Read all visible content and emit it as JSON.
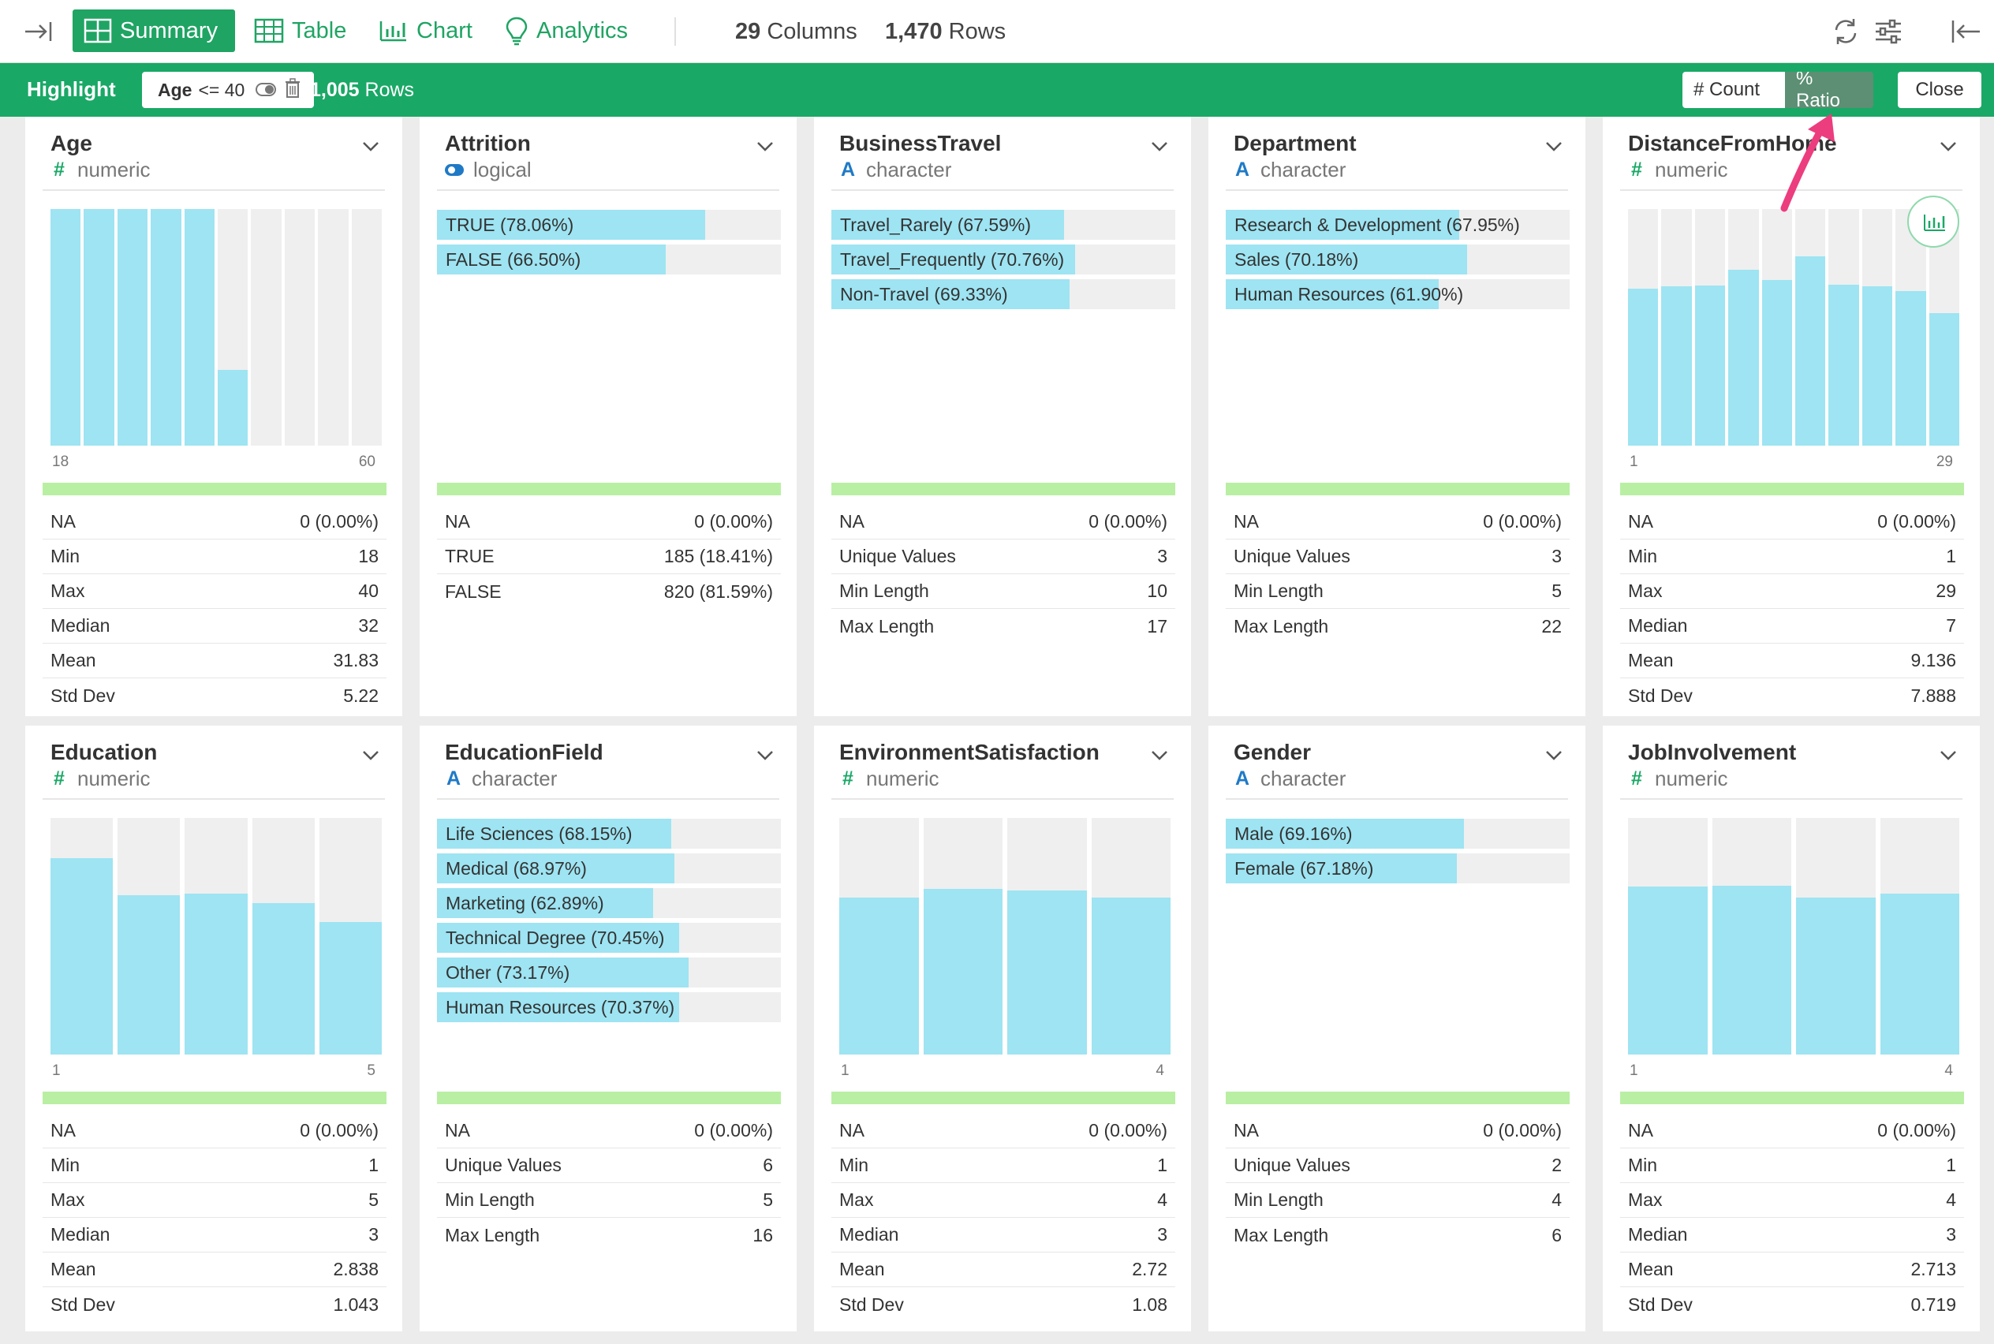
{
  "toolbar": {
    "tabs": [
      "Summary",
      "Table",
      "Chart",
      "Analytics"
    ],
    "columns_count": "29",
    "columns_label": "Columns",
    "rows_count": "1,470",
    "rows_label": "Rows"
  },
  "highlight": {
    "label": "Highlight",
    "filter_column": "Age",
    "filter_condition": "<= 40",
    "rows_count": "1,005",
    "rows_label": "Rows",
    "count_label": "# Count",
    "ratio_label": "% Ratio",
    "close_label": "Close"
  },
  "colors": {
    "accent": "#1aa866",
    "bar": "#9ee4f2",
    "bar_bg": "#efefef",
    "arrow": "#ec3d7e"
  },
  "cards": [
    {
      "title": "Age",
      "type": "numeric",
      "kind": "hist",
      "axis_min": "18",
      "axis_max": "60",
      "bars": [
        1,
        1,
        1,
        1,
        1,
        0.32,
        0,
        0,
        0,
        0
      ],
      "stats": [
        [
          "NA",
          "0 (0.00%)"
        ],
        [
          "Min",
          "18"
        ],
        [
          "Max",
          "40"
        ],
        [
          "Median",
          "32"
        ],
        [
          "Mean",
          "31.83"
        ],
        [
          "Std Dev",
          "5.22"
        ]
      ]
    },
    {
      "title": "Attrition",
      "type": "logical",
      "kind": "cat",
      "cats": [
        [
          "TRUE (78.06%)",
          78.06
        ],
        [
          "FALSE (66.50%)",
          66.5
        ]
      ],
      "stats": [
        [
          "NA",
          "0 (0.00%)"
        ],
        [
          "TRUE",
          "185 (18.41%)"
        ],
        [
          "FALSE",
          "820 (81.59%)"
        ]
      ]
    },
    {
      "title": "BusinessTravel",
      "type": "character",
      "kind": "cat",
      "cats": [
        [
          "Travel_Rarely (67.59%)",
          67.59
        ],
        [
          "Travel_Frequently (70.76%)",
          70.76
        ],
        [
          "Non-Travel (69.33%)",
          69.33
        ]
      ],
      "stats": [
        [
          "NA",
          "0 (0.00%)"
        ],
        [
          "Unique Values",
          "3"
        ],
        [
          "Min Length",
          "10"
        ],
        [
          "Max Length",
          "17"
        ]
      ]
    },
    {
      "title": "Department",
      "type": "character",
      "kind": "cat",
      "cats": [
        [
          "Research & Development (67.95%)",
          67.95
        ],
        [
          "Sales (70.18%)",
          70.18
        ],
        [
          "Human Resources (61.90%)",
          61.9
        ]
      ],
      "stats": [
        [
          "NA",
          "0 (0.00%)"
        ],
        [
          "Unique Values",
          "3"
        ],
        [
          "Min Length",
          "5"
        ],
        [
          "Max Length",
          "22"
        ]
      ]
    },
    {
      "title": "DistanceFromHome",
      "type": "numeric",
      "kind": "hist",
      "axis_min": "1",
      "axis_max": "29",
      "bars": [
        0.665,
        0.675,
        0.678,
        0.745,
        0.7,
        0.8,
        0.68,
        0.675,
        0.655,
        0.56
      ],
      "stats": [
        [
          "NA",
          "0 (0.00%)"
        ],
        [
          "Min",
          "1"
        ],
        [
          "Max",
          "29"
        ],
        [
          "Median",
          "7"
        ],
        [
          "Mean",
          "9.136"
        ],
        [
          "Std Dev",
          "7.888"
        ]
      ]
    },
    {
      "title": "Education",
      "type": "numeric",
      "kind": "hist",
      "axis_min": "1",
      "axis_max": "5",
      "bars": [
        0.83,
        0.675,
        0.68,
        0.64,
        0.56
      ],
      "stats": [
        [
          "NA",
          "0 (0.00%)"
        ],
        [
          "Min",
          "1"
        ],
        [
          "Max",
          "5"
        ],
        [
          "Median",
          "3"
        ],
        [
          "Mean",
          "2.838"
        ],
        [
          "Std Dev",
          "1.043"
        ]
      ]
    },
    {
      "title": "EducationField",
      "type": "character",
      "kind": "cat",
      "cats": [
        [
          "Life Sciences (68.15%)",
          68.15
        ],
        [
          "Medical (68.97%)",
          68.97
        ],
        [
          "Marketing (62.89%)",
          62.89
        ],
        [
          "Technical Degree (70.45%)",
          70.45
        ],
        [
          "Other (73.17%)",
          73.17
        ],
        [
          "Human Resources (70.37%)",
          70.37
        ]
      ],
      "stats": [
        [
          "NA",
          "0 (0.00%)"
        ],
        [
          "Unique Values",
          "6"
        ],
        [
          "Min Length",
          "5"
        ],
        [
          "Max Length",
          "16"
        ]
      ]
    },
    {
      "title": "EnvironmentSatisfaction",
      "type": "numeric",
      "kind": "hist",
      "axis_min": "1",
      "axis_max": "4",
      "bars": [
        0.665,
        0.7,
        0.695,
        0.665
      ],
      "stats": [
        [
          "NA",
          "0 (0.00%)"
        ],
        [
          "Min",
          "1"
        ],
        [
          "Max",
          "4"
        ],
        [
          "Median",
          "3"
        ],
        [
          "Mean",
          "2.72"
        ],
        [
          "Std Dev",
          "1.08"
        ]
      ]
    },
    {
      "title": "Gender",
      "type": "character",
      "kind": "cat",
      "cats": [
        [
          "Male (69.16%)",
          69.16
        ],
        [
          "Female (67.18%)",
          67.18
        ]
      ],
      "stats": [
        [
          "NA",
          "0 (0.00%)"
        ],
        [
          "Unique Values",
          "2"
        ],
        [
          "Min Length",
          "4"
        ],
        [
          "Max Length",
          "6"
        ]
      ]
    },
    {
      "title": "JobInvolvement",
      "type": "numeric",
      "kind": "hist",
      "axis_min": "1",
      "axis_max": "4",
      "bars": [
        0.71,
        0.715,
        0.665,
        0.68
      ],
      "stats": [
        [
          "NA",
          "0 (0.00%)"
        ],
        [
          "Min",
          "1"
        ],
        [
          "Max",
          "4"
        ],
        [
          "Median",
          "3"
        ],
        [
          "Mean",
          "2.713"
        ],
        [
          "Std Dev",
          "0.719"
        ]
      ]
    }
  ]
}
